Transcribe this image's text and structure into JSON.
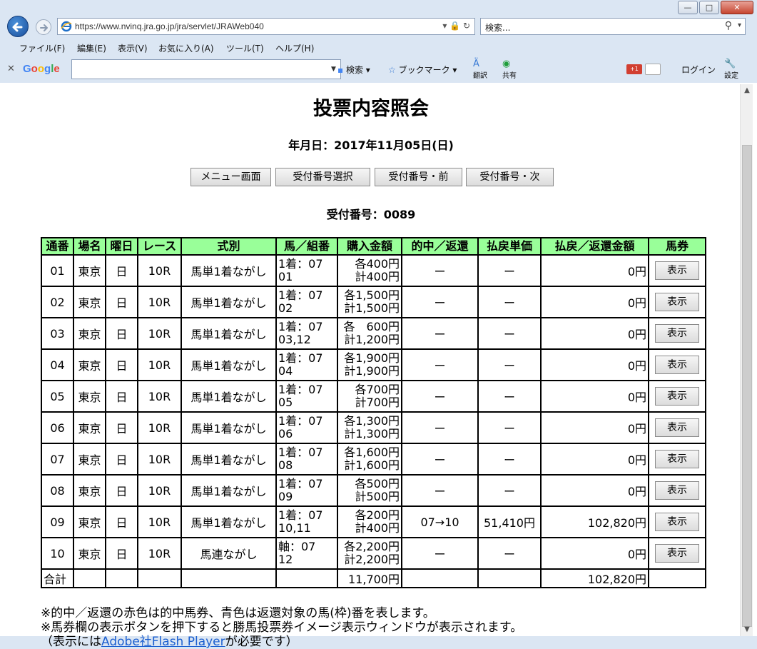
{
  "browser": {
    "url": "https://www.nvinq.jra.go.jp/jra/servlet/JRAWeb040",
    "search_placeholder": "検索...",
    "menu": [
      "ファイル(F)",
      "編集(E)",
      "表示(V)",
      "お気に入り(A)",
      "ツール(T)",
      "ヘルプ(H)"
    ],
    "google_toolbar": {
      "logo": "Google",
      "search_label": "検索",
      "bookmark_label": "ブックマーク",
      "translate_label": "翻訳",
      "share_label": "共有",
      "login_label": "ログイン",
      "settings_label": "設定",
      "gplus_label": "+1"
    }
  },
  "page": {
    "title": "投票内容照会",
    "date_line": "年月日：2017年11月05日(日)",
    "buttons": [
      "メニュー画面",
      "受付番号選択",
      "受付番号・前",
      "受付番号・次"
    ],
    "receipt_line": "受付番号：0089"
  },
  "table": {
    "headers": [
      "通番",
      "場名",
      "曜日",
      "レース",
      "式別",
      "馬／組番",
      "購入金額",
      "的中／返還",
      "払戻単価",
      "払戻／返還金額",
      "馬券"
    ],
    "rows": [
      {
        "no": "01",
        "venue": "東京",
        "day": "日",
        "race": "10R",
        "kind": "馬単1着ながし",
        "horse1": "1着：07",
        "horse2": "01",
        "amt1": "各400円",
        "amt2": "計400円",
        "hit": "ー",
        "unit": "ー",
        "payout": "0円",
        "btn": "表示"
      },
      {
        "no": "02",
        "venue": "東京",
        "day": "日",
        "race": "10R",
        "kind": "馬単1着ながし",
        "horse1": "1着：07",
        "horse2": "02",
        "amt1": "各1,500円",
        "amt2": "計1,500円",
        "hit": "ー",
        "unit": "ー",
        "payout": "0円",
        "btn": "表示"
      },
      {
        "no": "03",
        "venue": "東京",
        "day": "日",
        "race": "10R",
        "kind": "馬単1着ながし",
        "horse1": "1着：07",
        "horse2": "03,12",
        "amt1": "各　600円",
        "amt2": "計1,200円",
        "hit": "ー",
        "unit": "ー",
        "payout": "0円",
        "btn": "表示"
      },
      {
        "no": "04",
        "venue": "東京",
        "day": "日",
        "race": "10R",
        "kind": "馬単1着ながし",
        "horse1": "1着：07",
        "horse2": "04",
        "amt1": "各1,900円",
        "amt2": "計1,900円",
        "hit": "ー",
        "unit": "ー",
        "payout": "0円",
        "btn": "表示"
      },
      {
        "no": "05",
        "venue": "東京",
        "day": "日",
        "race": "10R",
        "kind": "馬単1着ながし",
        "horse1": "1着：07",
        "horse2": "05",
        "amt1": "各700円",
        "amt2": "計700円",
        "hit": "ー",
        "unit": "ー",
        "payout": "0円",
        "btn": "表示"
      },
      {
        "no": "06",
        "venue": "東京",
        "day": "日",
        "race": "10R",
        "kind": "馬単1着ながし",
        "horse1": "1着：07",
        "horse2": "06",
        "amt1": "各1,300円",
        "amt2": "計1,300円",
        "hit": "ー",
        "unit": "ー",
        "payout": "0円",
        "btn": "表示"
      },
      {
        "no": "07",
        "venue": "東京",
        "day": "日",
        "race": "10R",
        "kind": "馬単1着ながし",
        "horse1": "1着：07",
        "horse2": "08",
        "amt1": "各1,600円",
        "amt2": "計1,600円",
        "hit": "ー",
        "unit": "ー",
        "payout": "0円",
        "btn": "表示"
      },
      {
        "no": "08",
        "venue": "東京",
        "day": "日",
        "race": "10R",
        "kind": "馬単1着ながし",
        "horse1": "1着：07",
        "horse2": "09",
        "amt1": "各500円",
        "amt2": "計500円",
        "hit": "ー",
        "unit": "ー",
        "payout": "0円",
        "btn": "表示"
      },
      {
        "no": "09",
        "venue": "東京",
        "day": "日",
        "race": "10R",
        "kind": "馬単1着ながし",
        "horse1": "1着：07",
        "horse2": "10,11",
        "amt1": "各200円",
        "amt2": "計400円",
        "hit": "07→10",
        "unit": "51,410円",
        "payout": "102,820円",
        "btn": "表示",
        "is_hit": true
      },
      {
        "no": "10",
        "venue": "東京",
        "day": "日",
        "race": "10R",
        "kind": "馬連ながし",
        "horse1": "軸：07",
        "horse2": "12",
        "amt1": "各2,200円",
        "amt2": "計2,200円",
        "hit": "ー",
        "unit": "ー",
        "payout": "0円",
        "btn": "表示"
      }
    ],
    "total": {
      "label": "合計",
      "amount": "11,700円",
      "payout": "102,820円"
    }
  },
  "notes": {
    "line1": "※的中／返還の赤色は的中馬券、青色は返還対象の馬(枠)番を表します。",
    "line2": "※馬券欄の表示ボタンを押下すると勝馬投票券イメージ表示ウィンドウが表示されます。",
    "line3_prefix": "（表示には",
    "line3_link": "Adobe社Flash Player",
    "line3_suffix": "が必要です）"
  },
  "colors": {
    "header_bg": "#99ff99",
    "hit_text": "#e00000",
    "link": "#1b5fd0",
    "chrome_bg": "#dbe6f3"
  }
}
